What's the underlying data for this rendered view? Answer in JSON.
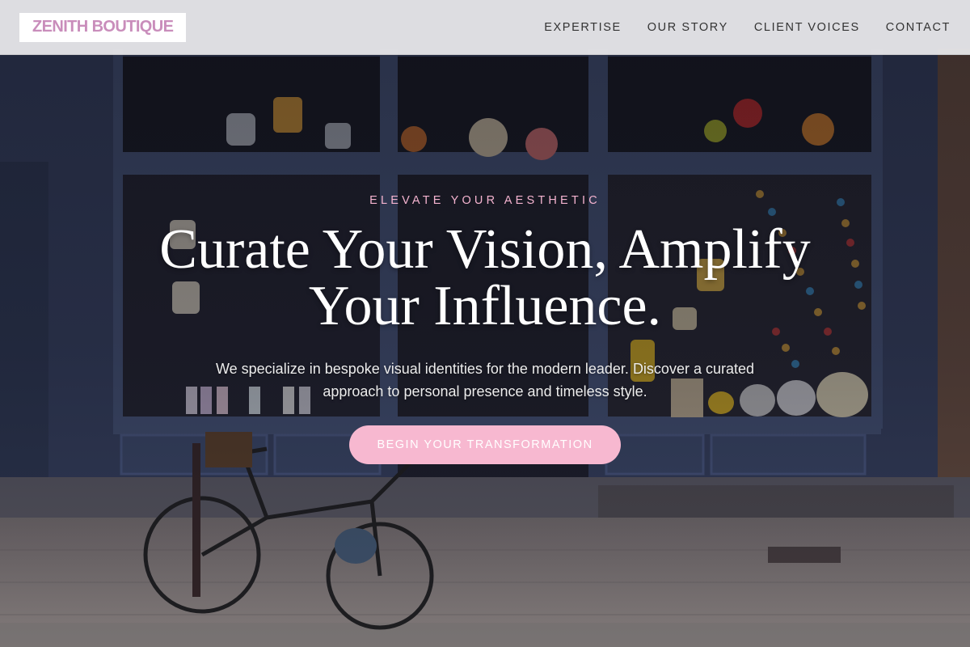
{
  "brand": {
    "name": "ZENITH BOUTIQUE"
  },
  "nav": {
    "items": [
      {
        "label": "EXPERTISE"
      },
      {
        "label": "OUR STORY"
      },
      {
        "label": "CLIENT VOICES"
      },
      {
        "label": "CONTACT"
      }
    ]
  },
  "hero": {
    "eyebrow": "ELEVATE YOUR AESTHETIC",
    "headline": "Curate Your Vision, Amplify Your Influence.",
    "subtext": "We specialize in bespoke visual identities for the modern leader. Discover a curated approach to personal presence and timeless style.",
    "cta_label": "BEGIN YOUR TRANSFORMATION",
    "background_image": "boutique-storefront-photo"
  },
  "colors": {
    "brand_pink": "#c98dbb",
    "accent_pink": "#f7b8d0",
    "eyebrow_pink": "#f4b3cf",
    "header_bg": "#ececee"
  }
}
